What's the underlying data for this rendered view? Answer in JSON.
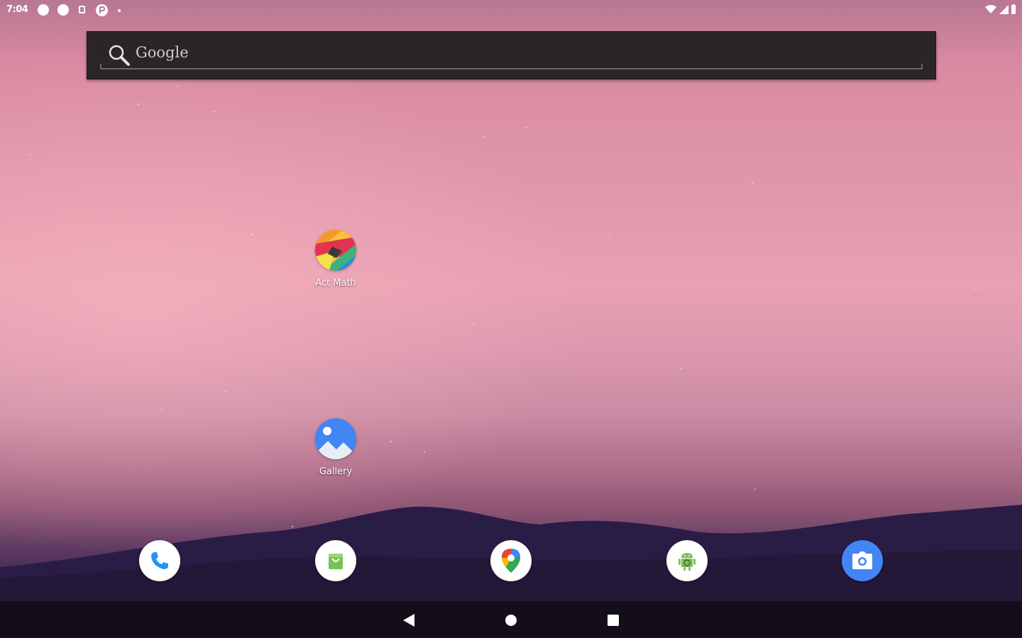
{
  "status_bar": {
    "time": "7:04"
  },
  "search": {
    "label": "Google"
  },
  "home_apps": [
    {
      "label": "Act Math",
      "icon": "act-math-icon"
    },
    {
      "label": "Gallery",
      "icon": "gallery-icon"
    }
  ],
  "dock": [
    {
      "icon": "phone-icon"
    },
    {
      "icon": "store-icon"
    },
    {
      "icon": "maps-icon"
    },
    {
      "icon": "android-icon"
    },
    {
      "icon": "camera-icon"
    }
  ],
  "colors": {
    "search_bg": "#2b2529",
    "nav_bg": "#140e1a",
    "accent_blue": "#4285f4",
    "android_green": "#78c257"
  }
}
